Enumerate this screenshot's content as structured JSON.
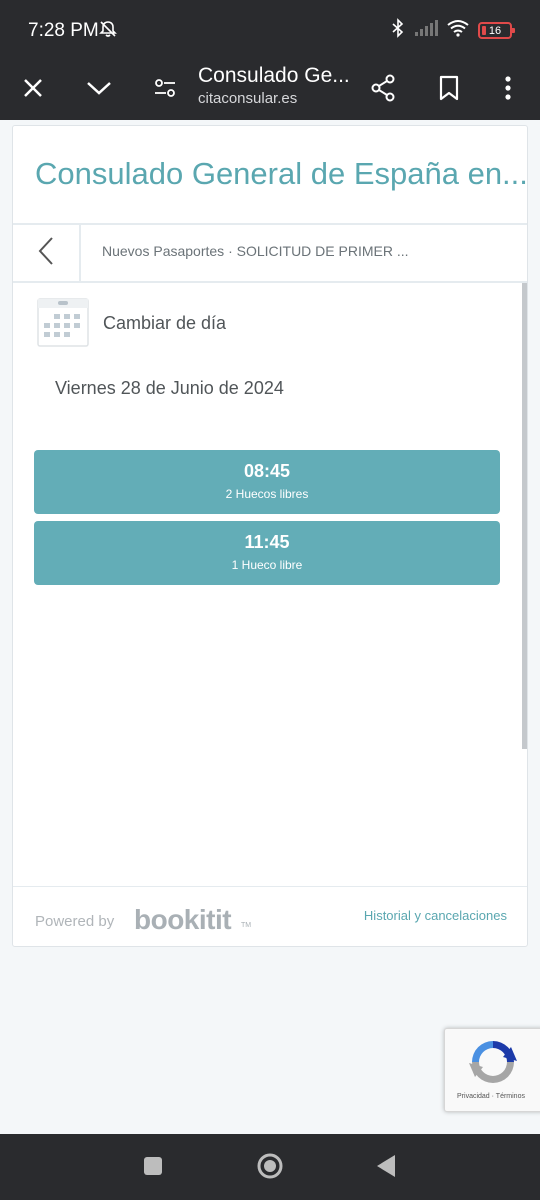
{
  "status_bar": {
    "time": "7:28 PM",
    "battery_level": "16",
    "icons": [
      "mute-icon",
      "bluetooth-icon",
      "signal-icon",
      "wifi-icon",
      "battery-icon"
    ]
  },
  "browser": {
    "title": "Consulado Ge...",
    "url": "citaconsular.es"
  },
  "page": {
    "title": "Consulado General de España en...",
    "breadcrumb": "Nuevos Pasaportes · SOLICITUD DE PRIMER ...",
    "change_day_label": "Cambiar de día",
    "date": "Viernes 28 de Junio de 2024",
    "slots": [
      {
        "time": "08:45",
        "availability": "2 Huecos libres"
      },
      {
        "time": "11:45",
        "availability": "1 Hueco libre"
      }
    ],
    "footer": {
      "powered_by": "Powered by",
      "brand": "bookitit",
      "brand_tm": "TM",
      "history_link": "Historial y cancelaciones"
    }
  },
  "recaptcha": {
    "links": "Privacidad · Términos"
  },
  "colors": {
    "accent": "#5aa7b0",
    "slot_background": "#63adb7",
    "system_bar": "#2a2b2e"
  }
}
